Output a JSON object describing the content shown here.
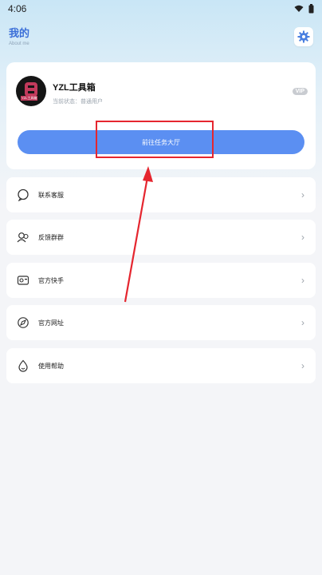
{
  "status_bar": {
    "time": "4:06"
  },
  "header": {
    "title": "我的",
    "subtitle": "About me"
  },
  "profile": {
    "name": "YZL工具箱",
    "status": "当前状态：普通用户",
    "avatar_tag": "YZL工具箱",
    "vip_badge": "VIP"
  },
  "task_hall_button": {
    "label": "前往任务大厅"
  },
  "menu": [
    {
      "label": "联系客服",
      "icon": "chat-bubble-icon"
    },
    {
      "label": "反馈群群",
      "icon": "group-icon"
    },
    {
      "label": "官方快手",
      "icon": "video-icon"
    },
    {
      "label": "官方网址",
      "icon": "compass-icon"
    },
    {
      "label": "使用帮助",
      "icon": "help-drop-icon"
    }
  ],
  "colors": {
    "accent": "#5b8ff2",
    "title": "#3b6fd8",
    "annotation": "#e5262f"
  }
}
